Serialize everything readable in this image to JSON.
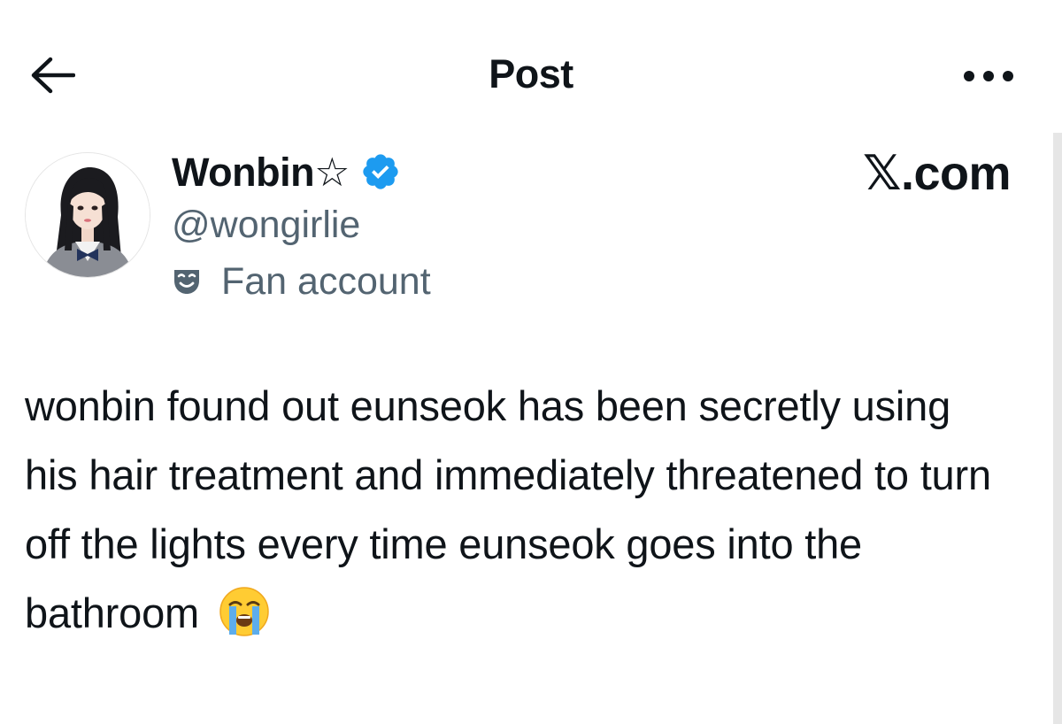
{
  "header": {
    "title": "Post",
    "back_icon": "back-arrow-icon",
    "more_icon": "more-horizontal-icon"
  },
  "author": {
    "display_name": "Wonbin☆",
    "handle": "@wongirlie",
    "label": "Fan account",
    "label_icon": "theater-mask-icon",
    "verified": true,
    "verified_color": "#1d9bf0"
  },
  "watermark": "𝕏.com",
  "post": {
    "text": "wonbin found out eunseok has been secretly using his hair treatment and immediately threatened to turn off the lights every time eunseok goes into the bathroom",
    "emoji": "😭",
    "emoji_name": "loudly-crying-face-emoji"
  },
  "colors": {
    "text_primary": "#0f1419",
    "text_secondary": "#536471",
    "accent": "#1d9bf0"
  }
}
